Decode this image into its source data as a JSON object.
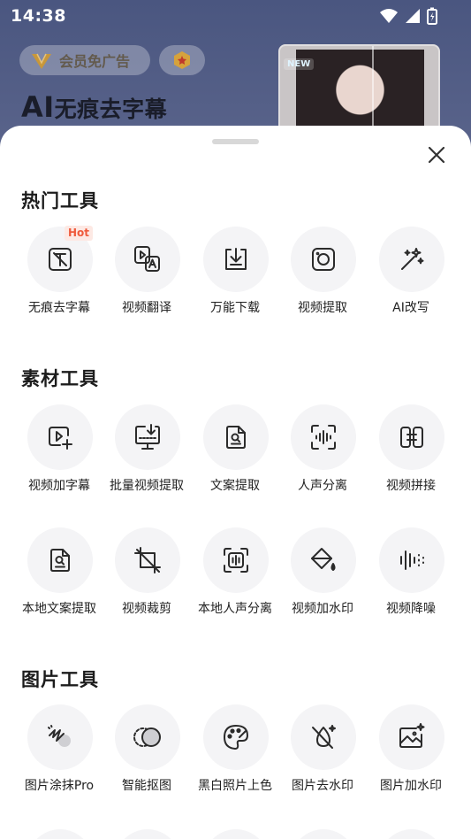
{
  "status_bar": {
    "time": "14:38"
  },
  "background": {
    "vip_label": "会员免广告",
    "hero_title_ai": "AI",
    "hero_title_rest": "无痕去字幕",
    "new_tag": "NEW"
  },
  "sheet": {
    "sections": [
      {
        "title": "热门工具",
        "tools": [
          {
            "label": "无痕去字幕",
            "icon": "text-remove-icon",
            "badge": "Hot"
          },
          {
            "label": "视频翻译",
            "icon": "video-translate-icon"
          },
          {
            "label": "万能下载",
            "icon": "download-icon"
          },
          {
            "label": "视频提取",
            "icon": "camera-icon"
          },
          {
            "label": "AI改写",
            "icon": "magic-wand-icon"
          }
        ]
      },
      {
        "title": "素材工具",
        "tools": [
          {
            "label": "视频加字幕",
            "icon": "video-add-caption-icon"
          },
          {
            "label": "批量视频提取",
            "icon": "batch-extract-icon"
          },
          {
            "label": "文案提取",
            "icon": "doc-search-icon"
          },
          {
            "label": "人声分离",
            "icon": "voice-separate-icon"
          },
          {
            "label": "视频拼接",
            "icon": "video-merge-icon"
          },
          {
            "label": "本地文案提取",
            "icon": "local-doc-icon"
          },
          {
            "label": "视频裁剪",
            "icon": "crop-icon"
          },
          {
            "label": "本地人声分离",
            "icon": "local-voice-icon"
          },
          {
            "label": "视频加水印",
            "icon": "paint-bucket-icon"
          },
          {
            "label": "视频降噪",
            "icon": "noise-reduce-icon"
          }
        ]
      },
      {
        "title": "图片工具",
        "tools": [
          {
            "label": "图片涂抹Pro",
            "icon": "brush-icon"
          },
          {
            "label": "智能抠图",
            "icon": "cutout-icon"
          },
          {
            "label": "黑白照片上色",
            "icon": "palette-icon"
          },
          {
            "label": "图片去水印",
            "icon": "drop-off-icon"
          },
          {
            "label": "图片加水印",
            "icon": "image-add-icon"
          }
        ]
      }
    ]
  }
}
